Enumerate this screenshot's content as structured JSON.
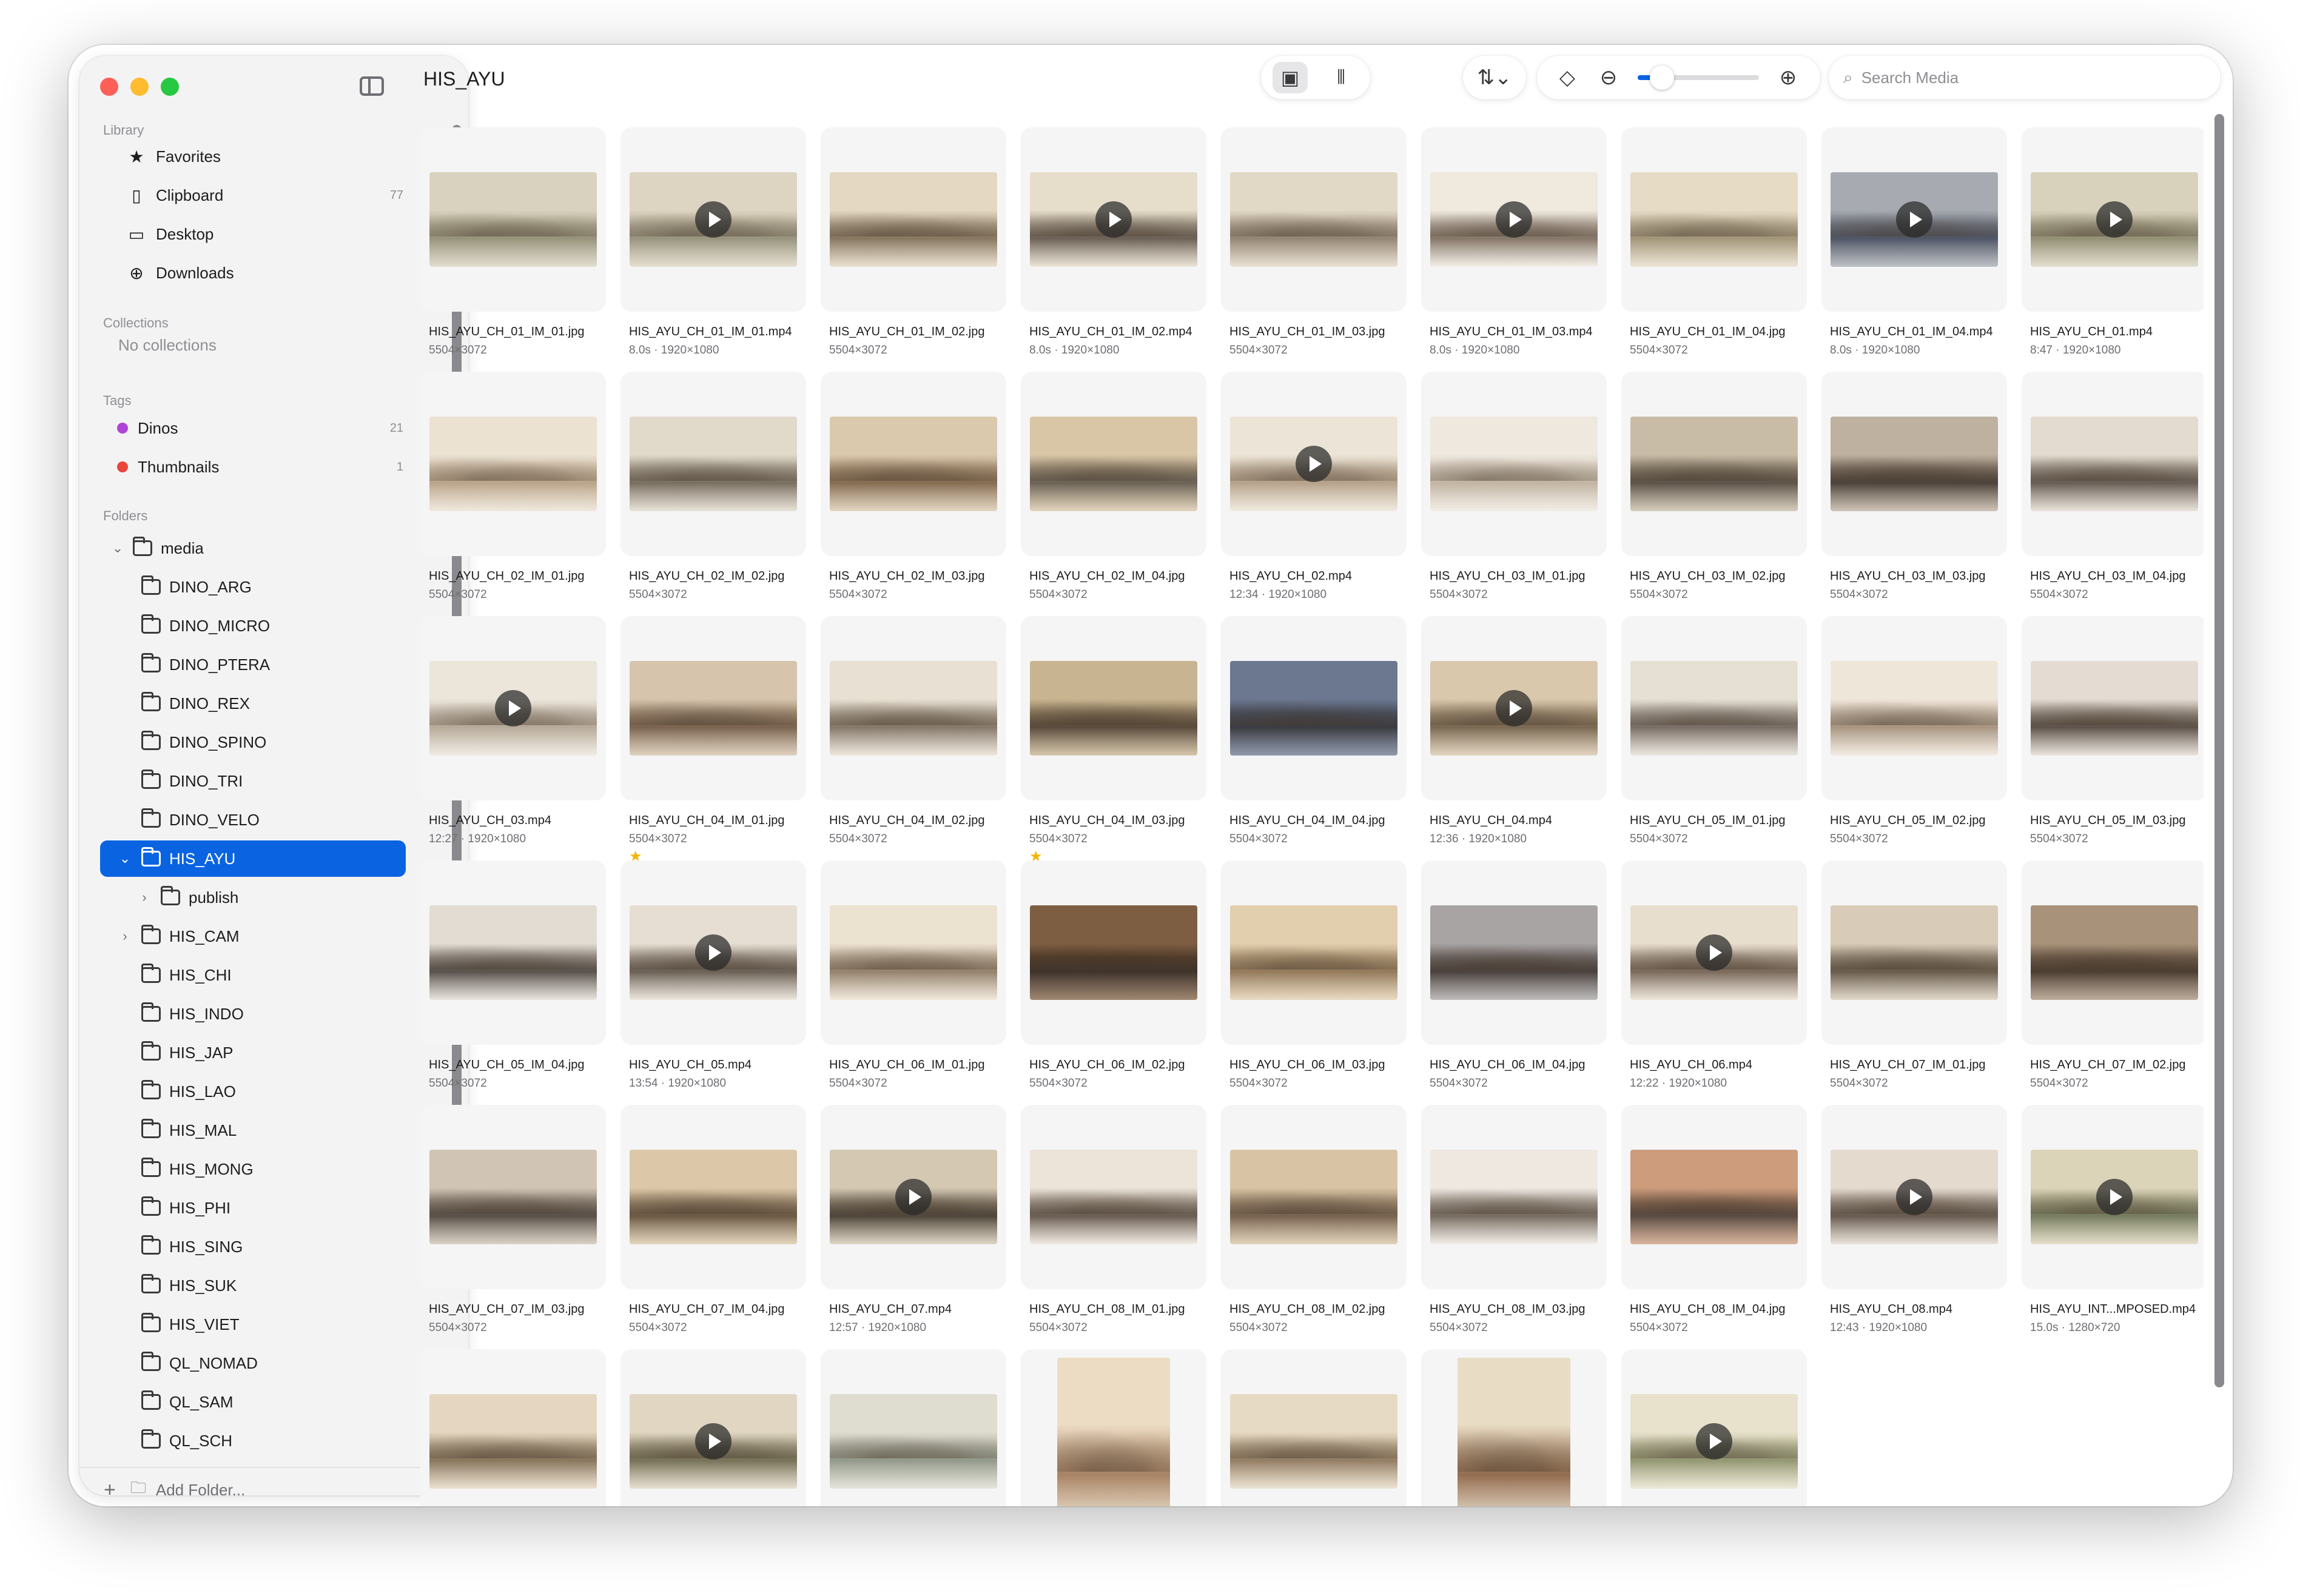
{
  "window": {
    "title": "HIS_AYU"
  },
  "sidebar": {
    "library_header": "Library",
    "library": [
      {
        "label": "Favorites",
        "icon": "star-icon",
        "glyph": "★",
        "count": ""
      },
      {
        "label": "Clipboard",
        "icon": "clipboard-icon",
        "glyph": "▯",
        "count": "77"
      },
      {
        "label": "Desktop",
        "icon": "desktop-icon",
        "glyph": "▭",
        "count": ""
      },
      {
        "label": "Downloads",
        "icon": "download-icon",
        "glyph": "⊕",
        "count": ""
      }
    ],
    "collections_header": "Collections",
    "collections_empty": "No collections",
    "tags_header": "Tags",
    "tags": [
      {
        "label": "Dinos",
        "color": "#b044d6",
        "count": "21"
      },
      {
        "label": "Thumbnails",
        "color": "#e8453c",
        "count": "1"
      }
    ],
    "folders_header": "Folders",
    "folders": [
      {
        "label": "media",
        "chevron": "⌄",
        "level": 0,
        "selected": false,
        "root": true
      },
      {
        "label": "DINO_ARG",
        "chevron": "",
        "level": 1,
        "selected": false
      },
      {
        "label": "DINO_MICRO",
        "chevron": "",
        "level": 1,
        "selected": false
      },
      {
        "label": "DINO_PTERA",
        "chevron": "",
        "level": 1,
        "selected": false
      },
      {
        "label": "DINO_REX",
        "chevron": "",
        "level": 1,
        "selected": false
      },
      {
        "label": "DINO_SPINO",
        "chevron": "",
        "level": 1,
        "selected": false
      },
      {
        "label": "DINO_TRI",
        "chevron": "",
        "level": 1,
        "selected": false
      },
      {
        "label": "DINO_VELO",
        "chevron": "",
        "level": 1,
        "selected": false
      },
      {
        "label": "HIS_AYU",
        "chevron": "⌄",
        "level": 1,
        "selected": true
      },
      {
        "label": "publish",
        "chevron": "›",
        "level": 2,
        "selected": false
      },
      {
        "label": "HIS_CAM",
        "chevron": "›",
        "level": 1,
        "selected": false
      },
      {
        "label": "HIS_CHI",
        "chevron": "",
        "level": 1,
        "selected": false
      },
      {
        "label": "HIS_INDO",
        "chevron": "",
        "level": 1,
        "selected": false
      },
      {
        "label": "HIS_JAP",
        "chevron": "",
        "level": 1,
        "selected": false
      },
      {
        "label": "HIS_LAO",
        "chevron": "",
        "level": 1,
        "selected": false
      },
      {
        "label": "HIS_MAL",
        "chevron": "",
        "level": 1,
        "selected": false
      },
      {
        "label": "HIS_MONG",
        "chevron": "",
        "level": 1,
        "selected": false
      },
      {
        "label": "HIS_PHI",
        "chevron": "",
        "level": 1,
        "selected": false
      },
      {
        "label": "HIS_SING",
        "chevron": "",
        "level": 1,
        "selected": false
      },
      {
        "label": "HIS_SUK",
        "chevron": "",
        "level": 1,
        "selected": false
      },
      {
        "label": "HIS_VIET",
        "chevron": "",
        "level": 1,
        "selected": false
      },
      {
        "label": "QL_NOMAD",
        "chevron": "",
        "level": 1,
        "selected": false
      },
      {
        "label": "QL_SAM",
        "chevron": "",
        "level": 1,
        "selected": false
      },
      {
        "label": "QL_SCH",
        "chevron": "",
        "level": 1,
        "selected": false
      }
    ],
    "add_folder_label": "Add Folder..."
  },
  "toolbar": {
    "view_modes": [
      {
        "name": "images-view-icon",
        "glyph": "▣",
        "active": true
      },
      {
        "name": "audio-waveform-icon",
        "glyph": "⦀",
        "active": false
      }
    ],
    "sort_glyph": "⇅⌄",
    "tag_glyph": "◇",
    "zoom_out_glyph": "⊖",
    "zoom_in_glyph": "⊕",
    "zoom_level": 0.2,
    "search_placeholder": "Search Media",
    "search_value": ""
  },
  "media": [
    {
      "name": "HIS_AYU_CH_01_IM_01.jpg",
      "meta": "5504×3072",
      "video": false,
      "c1": "#d9d2bf",
      "c2": "#8e8a6f"
    },
    {
      "name": "HIS_AYU_CH_01_IM_01.mp4",
      "meta": "8.0s · 1920×1080",
      "video": true,
      "c1": "#ddd5c1",
      "c2": "#8f8a72"
    },
    {
      "name": "HIS_AYU_CH_01_IM_02.jpg",
      "meta": "5504×3072",
      "video": false,
      "c1": "#e4d8c2",
      "c2": "#7c6a52"
    },
    {
      "name": "HIS_AYU_CH_01_IM_02.mp4",
      "meta": "8.0s · 1920×1080",
      "video": true,
      "c1": "#e6ddca",
      "c2": "#5e5246"
    },
    {
      "name": "HIS_AYU_CH_01_IM_03.jpg",
      "meta": "5504×3072",
      "video": false,
      "c1": "#e2d8c6",
      "c2": "#8a7a66"
    },
    {
      "name": "HIS_AYU_CH_01_IM_03.mp4",
      "meta": "8.0s · 1920×1080",
      "video": true,
      "c1": "#efe9de",
      "c2": "#7a6a5a"
    },
    {
      "name": "HIS_AYU_CH_01_IM_04.jpg",
      "meta": "5504×3072",
      "video": false,
      "c1": "#e6dcc6",
      "c2": "#9a8c6e"
    },
    {
      "name": "HIS_AYU_CH_01_IM_04.mp4",
      "meta": "8.0s · 1920×1080",
      "video": true,
      "c1": "#a7abb1",
      "c2": "#3f4657"
    },
    {
      "name": "HIS_AYU_CH_01.mp4",
      "meta": "8:47 · 1920×1080",
      "video": true,
      "c1": "#d8d2bd",
      "c2": "#8a866a"
    },
    {
      "name": "HIS_AYU_CH_02_IM_01.jpg",
      "meta": "5504×3072",
      "video": false,
      "c1": "#ebe2d2",
      "c2": "#b49c80"
    },
    {
      "name": "HIS_AYU_CH_02_IM_02.jpg",
      "meta": "5504×3072",
      "video": false,
      "c1": "#e1dacb",
      "c2": "#6d6252"
    },
    {
      "name": "HIS_AYU_CH_02_IM_03.jpg",
      "meta": "5504×3072",
      "video": false,
      "c1": "#dbc9ad",
      "c2": "#7a5f42"
    },
    {
      "name": "HIS_AYU_CH_02_IM_04.jpg",
      "meta": "5504×3072",
      "video": false,
      "c1": "#d9c6a6",
      "c2": "#5d5446"
    },
    {
      "name": "HIS_AYU_CH_02.mp4",
      "meta": "12:34 · 1920×1080",
      "video": true,
      "c1": "#ece4d6",
      "c2": "#b09a80"
    },
    {
      "name": "HIS_AYU_CH_03_IM_01.jpg",
      "meta": "5504×3072",
      "video": false,
      "c1": "#eee8de",
      "c2": "#bcae9a"
    },
    {
      "name": "HIS_AYU_CH_03_IM_02.jpg",
      "meta": "5504×3072",
      "video": false,
      "c1": "#c9bca6",
      "c2": "#4e4438"
    },
    {
      "name": "HIS_AYU_CH_03_IM_03.jpg",
      "meta": "5504×3072",
      "video": false,
      "c1": "#bfb1a0",
      "c2": "#3c3128"
    },
    {
      "name": "HIS_AYU_CH_03_IM_04.jpg",
      "meta": "5504×3072",
      "video": false,
      "c1": "#e3dbcf",
      "c2": "#5a4e44"
    },
    {
      "name": "HIS_AYU_CH_03.mp4",
      "meta": "12:27 · 1920×1080",
      "video": true,
      "c1": "#ebe5da",
      "c2": "#b0a290"
    },
    {
      "name": "HIS_AYU_CH_04_IM_01.jpg",
      "meta": "5504×3072",
      "video": false,
      "c1": "#d6c4ac",
      "c2": "#6e5640",
      "star": true
    },
    {
      "name": "HIS_AYU_CH_04_IM_02.jpg",
      "meta": "5504×3072",
      "video": false,
      "c1": "#e8e0d2",
      "c2": "#7a6c5c"
    },
    {
      "name": "HIS_AYU_CH_04_IM_03.jpg",
      "meta": "5504×3072",
      "video": false,
      "c1": "#c8b490",
      "c2": "#4a3a2a",
      "star": true
    },
    {
      "name": "HIS_AYU_CH_04_IM_04.jpg",
      "meta": "5504×3072",
      "video": false,
      "c1": "#6c7890",
      "c2": "#2a2a30"
    },
    {
      "name": "HIS_AYU_CH_04.mp4",
      "meta": "12:36 · 1920×1080",
      "video": true,
      "c1": "#d9c8ac",
      "c2": "#6e5a42"
    },
    {
      "name": "HIS_AYU_CH_05_IM_01.jpg",
      "meta": "5504×3072",
      "video": false,
      "c1": "#e6e0d4",
      "c2": "#6c6058"
    },
    {
      "name": "HIS_AYU_CH_05_IM_02.jpg",
      "meta": "5504×3072",
      "video": false,
      "c1": "#efe6da",
      "c2": "#a08c76"
    },
    {
      "name": "HIS_AYU_CH_05_IM_03.jpg",
      "meta": "5504×3072",
      "video": false,
      "c1": "#e4dcd2",
      "c2": "#4e4238"
    },
    {
      "name": "HIS_AYU_CH_05_IM_04.jpg",
      "meta": "5504×3072",
      "video": false,
      "c1": "#e2dcd2",
      "c2": "#4a423c"
    },
    {
      "name": "HIS_AYU_CH_05.mp4",
      "meta": "13:54 · 1920×1080",
      "video": true,
      "c1": "#e6ded2",
      "c2": "#5e5246"
    },
    {
      "name": "HIS_AYU_CH_06_IM_01.jpg",
      "meta": "5504×3072",
      "video": false,
      "c1": "#ece2d0",
      "c2": "#8c7660"
    },
    {
      "name": "HIS_AYU_CH_06_IM_02.jpg",
      "meta": "5504×3072",
      "video": false,
      "c1": "#7e5e42",
      "c2": "#2c2018"
    },
    {
      "name": "HIS_AYU_CH_06_IM_03.jpg",
      "meta": "5504×3072",
      "video": false,
      "c1": "#e2cfae",
      "c2": "#8a6e4c"
    },
    {
      "name": "HIS_AYU_CH_06_IM_04.jpg",
      "meta": "5504×3072",
      "video": false,
      "c1": "#a8a4a4",
      "c2": "#3a302c"
    },
    {
      "name": "HIS_AYU_CH_06.mp4",
      "meta": "12:22 · 1920×1080",
      "video": true,
      "c1": "#e8dece",
      "c2": "#6e5c4c"
    },
    {
      "name": "HIS_AYU_CH_07_IM_01.jpg",
      "meta": "5504×3072",
      "video": false,
      "c1": "#d8ccb8",
      "c2": "#5a4c3c"
    },
    {
      "name": "HIS_AYU_CH_07_IM_02.jpg",
      "meta": "5504×3072",
      "video": false,
      "c1": "#a8927a",
      "c2": "#3c2c20"
    },
    {
      "name": "HIS_AYU_CH_07_IM_03.jpg",
      "meta": "5504×3072",
      "video": false,
      "c1": "#d0c4b4",
      "c2": "#4a4038"
    },
    {
      "name": "HIS_AYU_CH_07_IM_04.jpg",
      "meta": "5504×3072",
      "video": false,
      "c1": "#dcc8a8",
      "c2": "#5e4a34"
    },
    {
      "name": "HIS_AYU_CH_07.mp4",
      "meta": "12:57 · 1920×1080",
      "video": true,
      "c1": "#d4c8b2",
      "c2": "#3e3428"
    },
    {
      "name": "HIS_AYU_CH_08_IM_01.jpg",
      "meta": "5504×3072",
      "video": false,
      "c1": "#ece4d8",
      "c2": "#5c4e42"
    },
    {
      "name": "HIS_AYU_CH_08_IM_02.jpg",
      "meta": "5504×3072",
      "video": false,
      "c1": "#d8c4a4",
      "c2": "#6a5440"
    },
    {
      "name": "HIS_AYU_CH_08_IM_03.jpg",
      "meta": "5504×3072",
      "video": false,
      "c1": "#eee8e0",
      "c2": "#6a5e52"
    },
    {
      "name": "HIS_AYU_CH_08_IM_04.jpg",
      "meta": "5504×3072",
      "video": false,
      "c1": "#cc9c7c",
      "c2": "#4a3a30"
    },
    {
      "name": "HIS_AYU_CH_08.mp4",
      "meta": "12:43 · 1920×1080",
      "video": true,
      "c1": "#e4dace",
      "c2": "#5a4c40"
    },
    {
      "name": "HIS_AYU_INT...MPOSED.mp4",
      "meta": "15.0s · 1280×720",
      "video": true,
      "c1": "#dcd4b8",
      "c2": "#6a7050"
    },
    {
      "name": "",
      "meta": "",
      "video": false,
      "c1": "#e4d6c0",
      "c2": "#7e6a4e"
    },
    {
      "name": "",
      "meta": "",
      "video": true,
      "c1": "#e0d6c2",
      "c2": "#6a6448"
    },
    {
      "name": "",
      "meta": "",
      "video": false,
      "c1": "#dfdcd0",
      "c2": "#8a9080"
    },
    {
      "name": "",
      "meta": "",
      "video": false,
      "c1": "#ecdcc4",
      "c2": "#a07856",
      "portrait": true
    },
    {
      "name": "",
      "meta": "",
      "video": false,
      "c1": "#e6dac4",
      "c2": "#8a7256"
    },
    {
      "name": "",
      "meta": "",
      "video": false,
      "c1": "#e8dcc4",
      "c2": "#8a6040",
      "portrait": true
    },
    {
      "name": "",
      "meta": "",
      "video": true,
      "c1": "#e8e2cc",
      "c2": "#8a8e66"
    }
  ]
}
